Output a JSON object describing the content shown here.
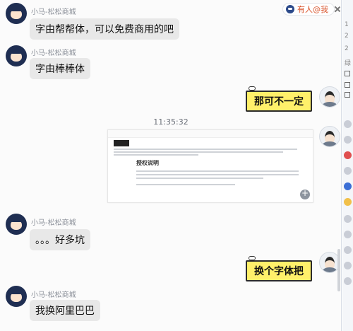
{
  "mention_banner": {
    "text": "有人@我",
    "icon": "user-icon"
  },
  "sidebar_glyphs": [
    "1",
    "2",
    "2",
    "绿"
  ],
  "messages": [
    {
      "sender": "小马-松松商城",
      "text": "字由帮帮体，可以免费商用的吧"
    },
    {
      "sender": "小马-松松商城",
      "text": "字由棒棒体"
    },
    {
      "sender": "",
      "text": "那可不一定"
    },
    {
      "sender": "小马-松松商城",
      "text": "。。。好多坑"
    },
    {
      "sender": "",
      "text": "换个字体把"
    },
    {
      "sender": "小马-松松商城",
      "text": "我换阿里巴巴"
    }
  ],
  "timestamp": "11:35:32",
  "image_message": {
    "heading": "授权说明"
  },
  "colors": {
    "incoming_bubble": "#e8e8e8",
    "outgoing_sticky": "#fff06a",
    "mention_text": "#d9532b"
  }
}
